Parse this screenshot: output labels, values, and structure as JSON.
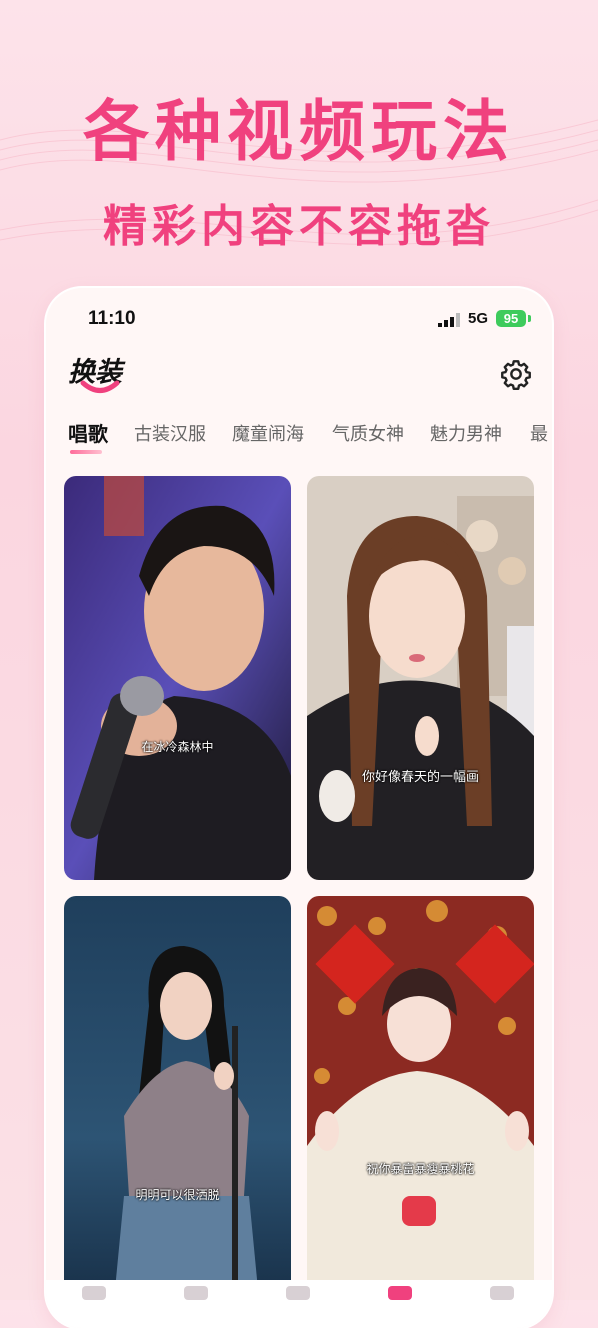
{
  "promo": {
    "headline": "各种视频玩法",
    "subheadline": "精彩内容不容拖沓"
  },
  "status_bar": {
    "time": "11:10",
    "network": "5G",
    "battery": "95"
  },
  "app": {
    "logo_text": "换装",
    "settings_icon": "gear-icon"
  },
  "tabs": [
    {
      "label": "唱歌",
      "active": true
    },
    {
      "label": "古装汉服",
      "active": false
    },
    {
      "label": "魔童闹海",
      "active": false
    },
    {
      "label": "气质女神",
      "active": false
    },
    {
      "label": "魅力男神",
      "active": false
    },
    {
      "label": "最",
      "active": false
    }
  ],
  "videos": [
    {
      "caption": "在冰冷森林中"
    },
    {
      "caption": "你好像春天的一幅画"
    },
    {
      "caption": "明明可以很洒脱"
    },
    {
      "caption": "祝你暴富暴瘦暴桃花"
    }
  ],
  "colors": {
    "accent": "#f0417e",
    "battery": "#3ecb5c",
    "background": "#fde3ea"
  }
}
